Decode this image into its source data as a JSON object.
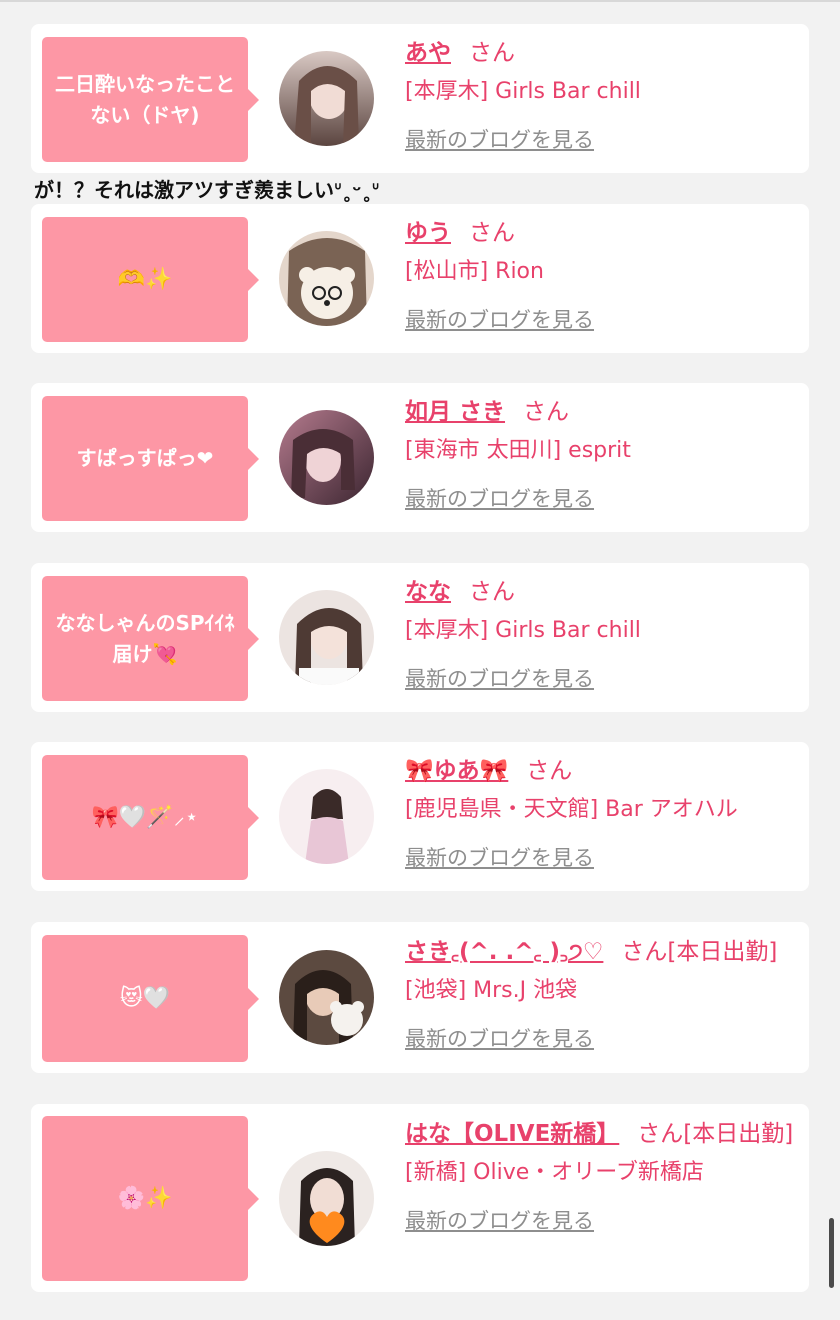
{
  "overflow_text": "が！？それは激アツすぎ羨ましいᐡ˳ᵕ˳ᐡ",
  "blog_link_label": "最新のブログを見る",
  "colors": {
    "accent": "#e8416b",
    "bubble": "#fd97a5",
    "background": "#f2f2f2"
  },
  "cards": [
    {
      "bubble": "二日酔いなったことない（ドヤ)",
      "name": "あや",
      "suffix": "さん",
      "shop": "[本厚木] Girls Bar chill",
      "avatar_colors": [
        "#d9c9c4",
        "#5b4540"
      ]
    },
    {
      "bubble": "🫶✨",
      "name": "ゆう",
      "suffix": "さん",
      "shop": "[松山市] Rion",
      "avatar_colors": [
        "#efe5da",
        "#6e5a4c"
      ]
    },
    {
      "bubble": "すぱっすぱっ❤",
      "name": "如月 さき",
      "suffix": "さん",
      "shop": "[東海市 太田川] esprit",
      "avatar_colors": [
        "#b57b8e",
        "#3b2530"
      ]
    },
    {
      "bubble": "ななしゃんのSPｲｲﾈ届け💘",
      "name": "なな",
      "suffix": "さん",
      "shop": "[本厚木] Girls Bar chill",
      "avatar_colors": [
        "#e7dcd9",
        "#4e3a34"
      ]
    },
    {
      "bubble": "🎀🤍🪄⸝⋆",
      "name": "🎀ゆあ🎀",
      "suffix": "さん",
      "shop": "[鹿児島県・天文館] Bar アオハル",
      "avatar_colors": [
        "#f7eef0",
        "#d8b8c8"
      ]
    },
    {
      "bubble": "😻🤍",
      "name": "さき꜀(^. .^꜀ )꜆੭♡",
      "suffix": "さん[本日出勤]",
      "shop": "[池袋] Mrs.J 池袋",
      "avatar_colors": [
        "#6b5448",
        "#2a1f1a"
      ]
    },
    {
      "bubble": "🌸✨",
      "name": "はな【OLIVE新橋】",
      "suffix": "さん[本日出勤]",
      "shop": "[新橋] Olive・オリーブ新橋店",
      "avatar_colors": [
        "#f0ebe8",
        "#2b2220"
      ]
    }
  ]
}
